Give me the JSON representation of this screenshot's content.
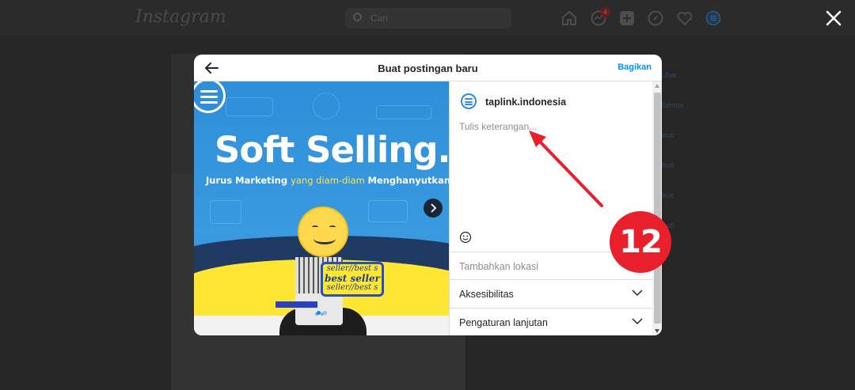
{
  "background": {
    "logo": "Instagram",
    "search_placeholder": "Cari",
    "notification_count": "4",
    "side_labels": [
      "Lihat",
      "Semua",
      "Ikuti",
      "Ikuti",
      "Ikuti",
      "Ikuti",
      "Ikuti"
    ]
  },
  "modal": {
    "title": "Buat postingan baru",
    "share_label": "Bagikan",
    "media": {
      "headline": "Soft Selling.",
      "sub_part1": "Jurus Marketing ",
      "sub_highlight": "yang diam-diam ",
      "sub_part2": "Menghanyutkan",
      "bubble_line1": "seller//best s",
      "bubble_line2": "best seller",
      "bubble_line3": "seller//best s"
    },
    "panel": {
      "username": "taplink.indonesia",
      "caption_placeholder": "Tulis keterangan...",
      "location_label": "Tambahkan lokasi",
      "accessibility_label": "Aksesibilitas",
      "advanced_label": "Pengaturan lanjutan"
    }
  },
  "annotation": {
    "step_number": "12",
    "color": "#ea1f2c"
  },
  "colors": {
    "accent": "#0095f6",
    "overlay": "#262626"
  }
}
